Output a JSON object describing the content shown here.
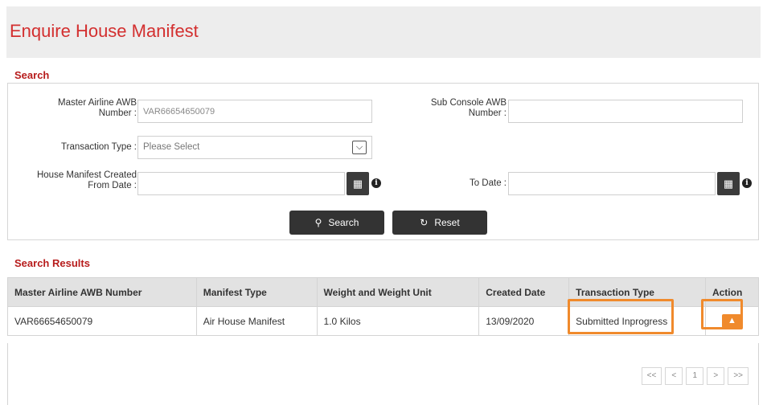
{
  "page": {
    "title": "Enquire House Manifest"
  },
  "search": {
    "section_title": "Search",
    "master_awb_label": "Master Airline AWB Number :",
    "master_awb_value": "VAR66654650079",
    "sub_console_label": "Sub Console AWB Number :",
    "sub_console_value": "",
    "transaction_type_label": "Transaction Type :",
    "transaction_type_selected": "Please Select",
    "from_date_label": "House Manifest Created From Date :",
    "from_date_value": "",
    "to_date_label": "To Date :",
    "to_date_value": "",
    "search_button": "Search",
    "reset_button": "Reset",
    "icons": {
      "calendar": "calendar-icon",
      "info": "info-icon",
      "search": "search-icon",
      "reset": "refresh-icon"
    }
  },
  "results": {
    "section_title": "Search Results",
    "columns": [
      "Master Airline AWB Number",
      "Manifest Type",
      "Weight and Weight Unit",
      "Created Date",
      "Transaction Type",
      "Action"
    ],
    "rows": [
      {
        "awb": "VAR66654650079",
        "manifest_type": "Air House Manifest",
        "weight": "1.0 Kilos",
        "created_date": "13/09/2020",
        "transaction_type": "Submitted Inprogress",
        "action_icon": "upload-icon"
      }
    ],
    "pager": {
      "first": "<<",
      "prev": "<",
      "page": "1",
      "next": ">",
      "last": ">>"
    }
  },
  "colors": {
    "title": "#d32f2f",
    "section": "#b71c1c",
    "highlight": "#f08a2c",
    "button": "#333333"
  }
}
